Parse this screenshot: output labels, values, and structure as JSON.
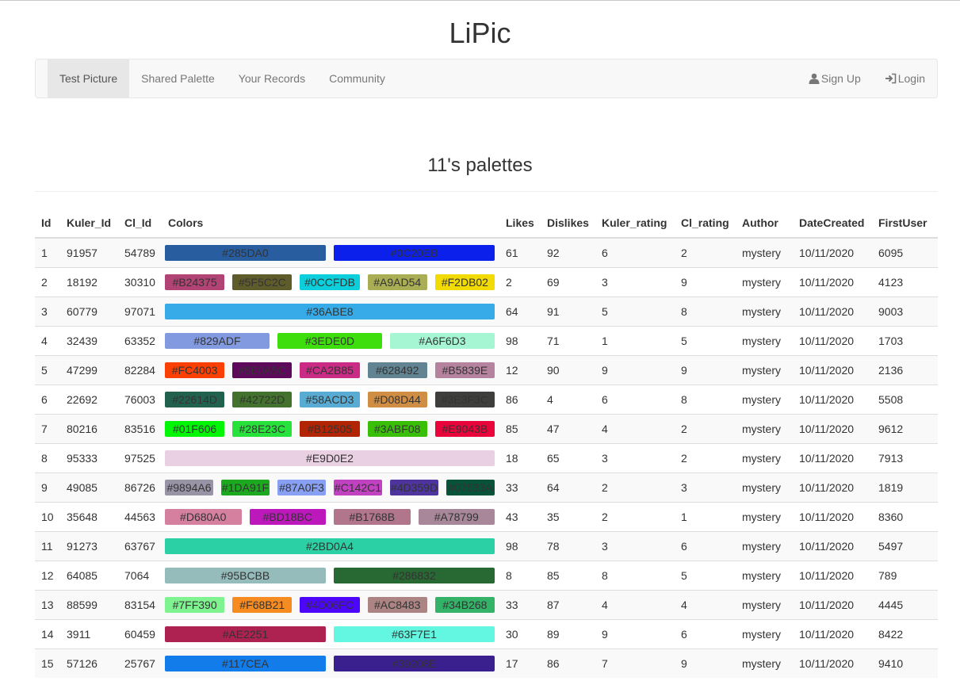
{
  "app": {
    "brand": "LiPic"
  },
  "nav": {
    "items": [
      "Test Picture",
      "Shared Palette",
      "Your Records",
      "Community"
    ],
    "active": 0,
    "signup": "Sign Up",
    "login": "Login"
  },
  "page": {
    "title": "11's palettes"
  },
  "table": {
    "headers": [
      "Id",
      "Kuler_Id",
      "Cl_Id",
      "Colors",
      "Likes",
      "Dislikes",
      "Kuler_rating",
      "Cl_rating",
      "Author",
      "DateCreated",
      "FirstUser"
    ],
    "rows": [
      {
        "id": "1",
        "kuler_id": "91957",
        "cl_id": "54789",
        "colors": [
          "#285DA0",
          "#0C20EB"
        ],
        "likes": "61",
        "dislikes": "92",
        "kuler_rating": "6",
        "cl_rating": "2",
        "author": "mystery",
        "date": "10/11/2020",
        "first_user": "6095"
      },
      {
        "id": "2",
        "kuler_id": "18192",
        "cl_id": "30310",
        "colors": [
          "#B24375",
          "#5F5C2C",
          "#0CCFDB",
          "#A9AD54",
          "#F2DB02"
        ],
        "likes": "2",
        "dislikes": "69",
        "kuler_rating": "3",
        "cl_rating": "9",
        "author": "mystery",
        "date": "10/11/2020",
        "first_user": "4123"
      },
      {
        "id": "3",
        "kuler_id": "60779",
        "cl_id": "97071",
        "colors": [
          "#36ABE8"
        ],
        "likes": "64",
        "dislikes": "91",
        "kuler_rating": "5",
        "cl_rating": "8",
        "author": "mystery",
        "date": "10/11/2020",
        "first_user": "9003"
      },
      {
        "id": "4",
        "kuler_id": "32439",
        "cl_id": "63352",
        "colors": [
          "#829ADF",
          "#3EDE0D",
          "#A6F6D3"
        ],
        "likes": "98",
        "dislikes": "71",
        "kuler_rating": "1",
        "cl_rating": "5",
        "author": "mystery",
        "date": "10/11/2020",
        "first_user": "1703"
      },
      {
        "id": "5",
        "kuler_id": "47299",
        "cl_id": "82284",
        "colors": [
          "#FC4003",
          "#5E0A5C",
          "#CA2B85",
          "#628492",
          "#B5839E"
        ],
        "likes": "12",
        "dislikes": "90",
        "kuler_rating": "9",
        "cl_rating": "9",
        "author": "mystery",
        "date": "10/11/2020",
        "first_user": "2136"
      },
      {
        "id": "6",
        "kuler_id": "22692",
        "cl_id": "76003",
        "colors": [
          "#22614D",
          "#42722D",
          "#58ACD3",
          "#D08D44",
          "#3E3F3C"
        ],
        "likes": "86",
        "dislikes": "4",
        "kuler_rating": "6",
        "cl_rating": "8",
        "author": "mystery",
        "date": "10/11/2020",
        "first_user": "5508"
      },
      {
        "id": "7",
        "kuler_id": "80216",
        "cl_id": "83516",
        "colors": [
          "#01F606",
          "#28E23C",
          "#B12505",
          "#3ABF08",
          "#E9043B"
        ],
        "likes": "85",
        "dislikes": "47",
        "kuler_rating": "4",
        "cl_rating": "2",
        "author": "mystery",
        "date": "10/11/2020",
        "first_user": "9612"
      },
      {
        "id": "8",
        "kuler_id": "95333",
        "cl_id": "97525",
        "colors": [
          "#E9D0E2"
        ],
        "likes": "18",
        "dislikes": "65",
        "kuler_rating": "3",
        "cl_rating": "2",
        "author": "mystery",
        "date": "10/11/2020",
        "first_user": "7913"
      },
      {
        "id": "9",
        "kuler_id": "49085",
        "cl_id": "86726",
        "colors": [
          "#9894A6",
          "#1DA91F",
          "#87A0F3",
          "#C142C1",
          "#4D359D",
          "#07533A"
        ],
        "likes": "33",
        "dislikes": "64",
        "kuler_rating": "2",
        "cl_rating": "3",
        "author": "mystery",
        "date": "10/11/2020",
        "first_user": "1819"
      },
      {
        "id": "10",
        "kuler_id": "35648",
        "cl_id": "44563",
        "colors": [
          "#D680A0",
          "#BD18BC",
          "#B1768B",
          "#A78799"
        ],
        "likes": "43",
        "dislikes": "35",
        "kuler_rating": "2",
        "cl_rating": "1",
        "author": "mystery",
        "date": "10/11/2020",
        "first_user": "8360"
      },
      {
        "id": "11",
        "kuler_id": "91273",
        "cl_id": "63767",
        "colors": [
          "#2BD0A4"
        ],
        "likes": "98",
        "dislikes": "78",
        "kuler_rating": "3",
        "cl_rating": "6",
        "author": "mystery",
        "date": "10/11/2020",
        "first_user": "5497"
      },
      {
        "id": "12",
        "kuler_id": "64085",
        "cl_id": "7064",
        "colors": [
          "#95BCBB",
          "#286832"
        ],
        "likes": "8",
        "dislikes": "85",
        "kuler_rating": "8",
        "cl_rating": "5",
        "author": "mystery",
        "date": "10/11/2020",
        "first_user": "789"
      },
      {
        "id": "13",
        "kuler_id": "88599",
        "cl_id": "83154",
        "colors": [
          "#7FF390",
          "#F68B21",
          "#4D06FC",
          "#AC8483",
          "#34B268"
        ],
        "likes": "33",
        "dislikes": "87",
        "kuler_rating": "4",
        "cl_rating": "4",
        "author": "mystery",
        "date": "10/11/2020",
        "first_user": "4445"
      },
      {
        "id": "14",
        "kuler_id": "3911",
        "cl_id": "60459",
        "colors": [
          "#AE2251",
          "#63F7E1"
        ],
        "likes": "30",
        "dislikes": "89",
        "kuler_rating": "9",
        "cl_rating": "6",
        "author": "mystery",
        "date": "10/11/2020",
        "first_user": "8422"
      },
      {
        "id": "15",
        "kuler_id": "57126",
        "cl_id": "25767",
        "colors": [
          "#117CEA",
          "#39208E"
        ],
        "likes": "17",
        "dislikes": "86",
        "kuler_rating": "7",
        "cl_rating": "9",
        "author": "mystery",
        "date": "10/11/2020",
        "first_user": "9410"
      }
    ]
  },
  "theme": {
    "navbar_bg": "#f8f8f8",
    "active_tab_bg": "#e7e7e7",
    "stripe": "#f9f9f9"
  },
  "icons": {
    "signup": "user-icon",
    "login": "login-icon"
  }
}
